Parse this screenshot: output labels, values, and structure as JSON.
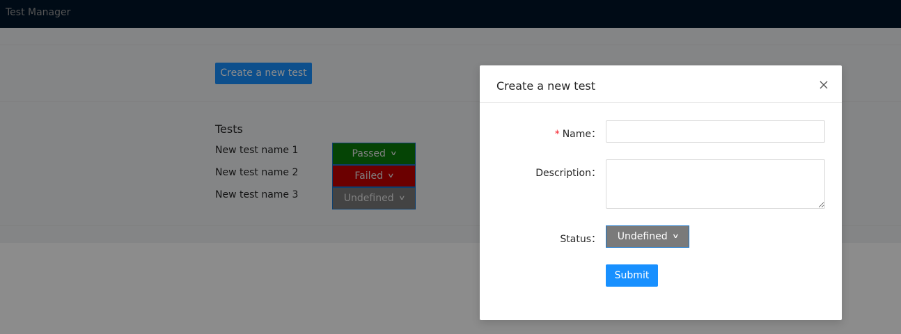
{
  "header": {
    "app_title": "Test Manager"
  },
  "main": {
    "create_button_label": "Create a new test",
    "tests_heading": "Tests",
    "tests": [
      {
        "name": "New test name 1",
        "status": "Passed",
        "color": "#0a7d0a"
      },
      {
        "name": "New test name 2",
        "status": "Failed",
        "color": "#c40000"
      },
      {
        "name": "New test name 3",
        "status": "Undefined",
        "color": "#7a7a7a"
      }
    ]
  },
  "modal": {
    "title": "Create a new test",
    "name_label": "Name",
    "name_value": "",
    "description_label": "Description",
    "description_value": "",
    "status_label": "Status",
    "status_value": "Undefined",
    "submit_label": "Submit"
  },
  "colors": {
    "header_bg": "#001529",
    "primary": "#1890ff",
    "required": "#f5222d",
    "overlay": "rgba(0,0,0,0.45)"
  }
}
